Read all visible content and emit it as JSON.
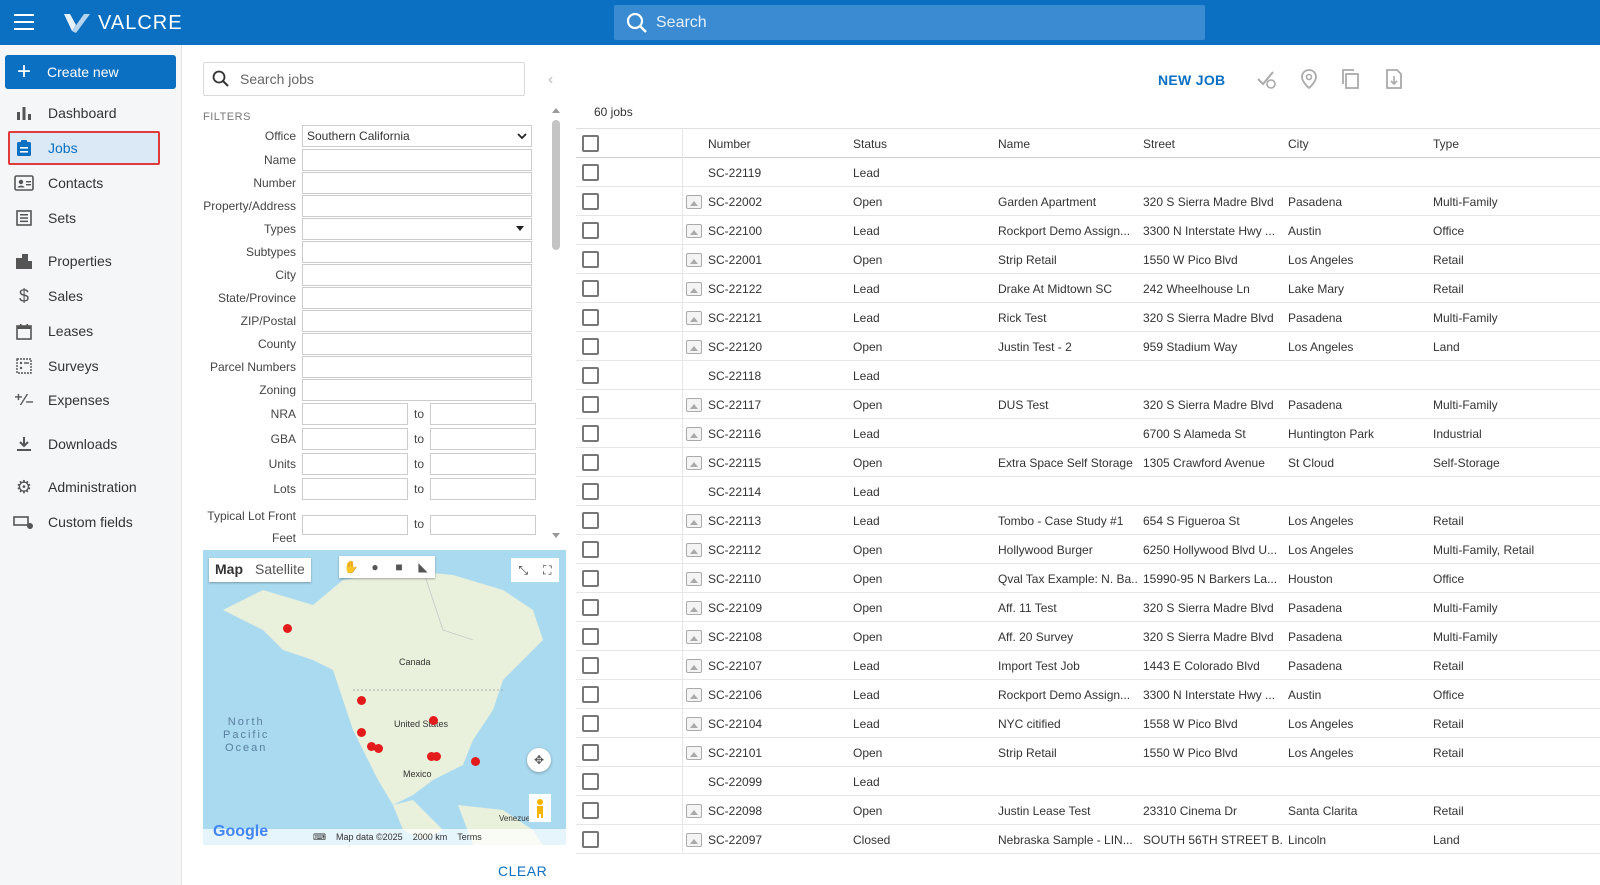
{
  "app": {
    "brand": "VALCRE",
    "search_placeholder": "Search"
  },
  "sidebar": {
    "create_label": "Create new",
    "items": [
      {
        "label": "Dashboard",
        "icon": "bar-chart-icon"
      },
      {
        "label": "Jobs",
        "icon": "clipboard-icon",
        "active": true
      },
      {
        "label": "Contacts",
        "icon": "contact-card-icon"
      },
      {
        "label": "Sets",
        "icon": "list-icon"
      },
      {
        "label": "Properties",
        "icon": "buildings-icon"
      },
      {
        "label": "Sales",
        "icon": "dollar-icon"
      },
      {
        "label": "Leases",
        "icon": "calendar-icon"
      },
      {
        "label": "Surveys",
        "icon": "survey-icon"
      },
      {
        "label": "Expenses",
        "icon": "plus-minus-icon"
      },
      {
        "label": "Downloads",
        "icon": "download-icon"
      },
      {
        "label": "Administration",
        "icon": "gear-icon"
      },
      {
        "label": "Custom fields",
        "icon": "custom-fields-icon"
      }
    ]
  },
  "filters": {
    "search_placeholder": "Search jobs",
    "heading": "FILTERS",
    "office_label": "Office",
    "office_value": "Southern California",
    "fields": [
      "Name",
      "Number",
      "Property/Address",
      "Types",
      "Subtypes",
      "City",
      "State/Province",
      "ZIP/Postal",
      "County",
      "Parcel Numbers",
      "Zoning"
    ],
    "range_fields": [
      "NRA",
      "GBA",
      "Units",
      "Lots"
    ],
    "last_field_line1": "Typical Lot Front",
    "last_field_line2": "Feet",
    "to_label": "to",
    "clear_label": "CLEAR"
  },
  "map": {
    "map_label": "Map",
    "satellite_label": "Satellite",
    "labels": {
      "canada": "Canada",
      "us": "United States",
      "mexico": "Mexico",
      "pacific1": "North",
      "pacific2": "Pacific",
      "pacific3": "Ocean",
      "venezuela": "Venezuela"
    },
    "footer_data": "Map data ©2025",
    "footer_scale": "2000 km",
    "footer_terms": "Terms",
    "google": "Google"
  },
  "main": {
    "new_job_label": "NEW JOB",
    "jobs_count": "60 jobs",
    "columns": [
      "Number",
      "Status",
      "Name",
      "Street",
      "City",
      "Type"
    ],
    "rows": [
      {
        "number": "SC-22119",
        "status": "Lead",
        "name": "",
        "street": "",
        "city": "",
        "type": "",
        "img": false
      },
      {
        "number": "SC-22002",
        "status": "Open",
        "name": "Garden Apartment",
        "street": "320 S Sierra Madre Blvd",
        "city": "Pasadena",
        "type": "Multi-Family",
        "img": true
      },
      {
        "number": "SC-22100",
        "status": "Lead",
        "name": "Rockport Demo Assign...",
        "street": "3300 N Interstate Hwy ...",
        "city": "Austin",
        "type": "Office",
        "img": true
      },
      {
        "number": "SC-22001",
        "status": "Open",
        "name": "Strip Retail",
        "street": "1550 W Pico Blvd",
        "city": "Los Angeles",
        "type": "Retail",
        "img": true
      },
      {
        "number": "SC-22122",
        "status": "Lead",
        "name": "Drake At Midtown SC",
        "street": "242 Wheelhouse Ln",
        "city": "Lake Mary",
        "type": "Retail",
        "img": true
      },
      {
        "number": "SC-22121",
        "status": "Lead",
        "name": "Rick Test",
        "street": "320 S Sierra Madre Blvd",
        "city": "Pasadena",
        "type": "Multi-Family",
        "img": true
      },
      {
        "number": "SC-22120",
        "status": "Open",
        "name": "Justin Test - 2",
        "street": "959 Stadium Way",
        "city": "Los Angeles",
        "type": "Land",
        "img": true
      },
      {
        "number": "SC-22118",
        "status": "Lead",
        "name": "",
        "street": "",
        "city": "",
        "type": "",
        "img": false
      },
      {
        "number": "SC-22117",
        "status": "Open",
        "name": "DUS Test",
        "street": "320 S Sierra Madre Blvd",
        "city": "Pasadena",
        "type": "Multi-Family",
        "img": true
      },
      {
        "number": "SC-22116",
        "status": "Lead",
        "name": "",
        "street": "6700 S Alameda St",
        "city": "Huntington Park",
        "type": "Industrial",
        "img": true
      },
      {
        "number": "SC-22115",
        "status": "Open",
        "name": "Extra Space Self Storage",
        "street": "1305 Crawford Avenue",
        "city": "St Cloud",
        "type": "Self-Storage",
        "img": true
      },
      {
        "number": "SC-22114",
        "status": "Lead",
        "name": "",
        "street": "",
        "city": "",
        "type": "",
        "img": false
      },
      {
        "number": "SC-22113",
        "status": "Lead",
        "name": "Tombo - Case Study #1",
        "street": "654 S Figueroa St",
        "city": "Los Angeles",
        "type": "Retail",
        "img": true
      },
      {
        "number": "SC-22112",
        "status": "Open",
        "name": "Hollywood Burger",
        "street": "6250 Hollywood Blvd U...",
        "city": "Los Angeles",
        "type": "Multi-Family, Retail",
        "img": true
      },
      {
        "number": "SC-22110",
        "status": "Open",
        "name": "Qval Tax Example: N. Ba...",
        "street": "15990-95 N Barkers La...",
        "city": "Houston",
        "type": "Office",
        "img": true
      },
      {
        "number": "SC-22109",
        "status": "Open",
        "name": "Aff. 11 Test",
        "street": "320 S Sierra Madre Blvd",
        "city": "Pasadena",
        "type": "Multi-Family",
        "img": true
      },
      {
        "number": "SC-22108",
        "status": "Open",
        "name": "Aff. 20 Survey",
        "street": "320 S Sierra Madre Blvd",
        "city": "Pasadena",
        "type": "Multi-Family",
        "img": true
      },
      {
        "number": "SC-22107",
        "status": "Lead",
        "name": "Import Test Job",
        "street": "1443 E Colorado Blvd",
        "city": "Pasadena",
        "type": "Retail",
        "img": true
      },
      {
        "number": "SC-22106",
        "status": "Lead",
        "name": "Rockport Demo Assign...",
        "street": "3300 N Interstate Hwy ...",
        "city": "Austin",
        "type": "Office",
        "img": true
      },
      {
        "number": "SC-22104",
        "status": "Lead",
        "name": "NYC citified",
        "street": "1558 W Pico Blvd",
        "city": "Los Angeles",
        "type": "Retail",
        "img": true
      },
      {
        "number": "SC-22101",
        "status": "Open",
        "name": "Strip Retail",
        "street": "1550 W Pico Blvd",
        "city": "Los Angeles",
        "type": "Retail",
        "img": true
      },
      {
        "number": "SC-22099",
        "status": "Lead",
        "name": "",
        "street": "",
        "city": "",
        "type": "",
        "img": false
      },
      {
        "number": "SC-22098",
        "status": "Open",
        "name": "Justin Lease Test",
        "street": "23310 Cinema Dr",
        "city": "Santa Clarita",
        "type": "Retail",
        "img": true
      },
      {
        "number": "SC-22097",
        "status": "Closed",
        "name": "Nebraska Sample - LIN...",
        "street": "SOUTH 56TH STREET B...",
        "city": "Lincoln",
        "type": "Land",
        "img": true
      }
    ]
  }
}
